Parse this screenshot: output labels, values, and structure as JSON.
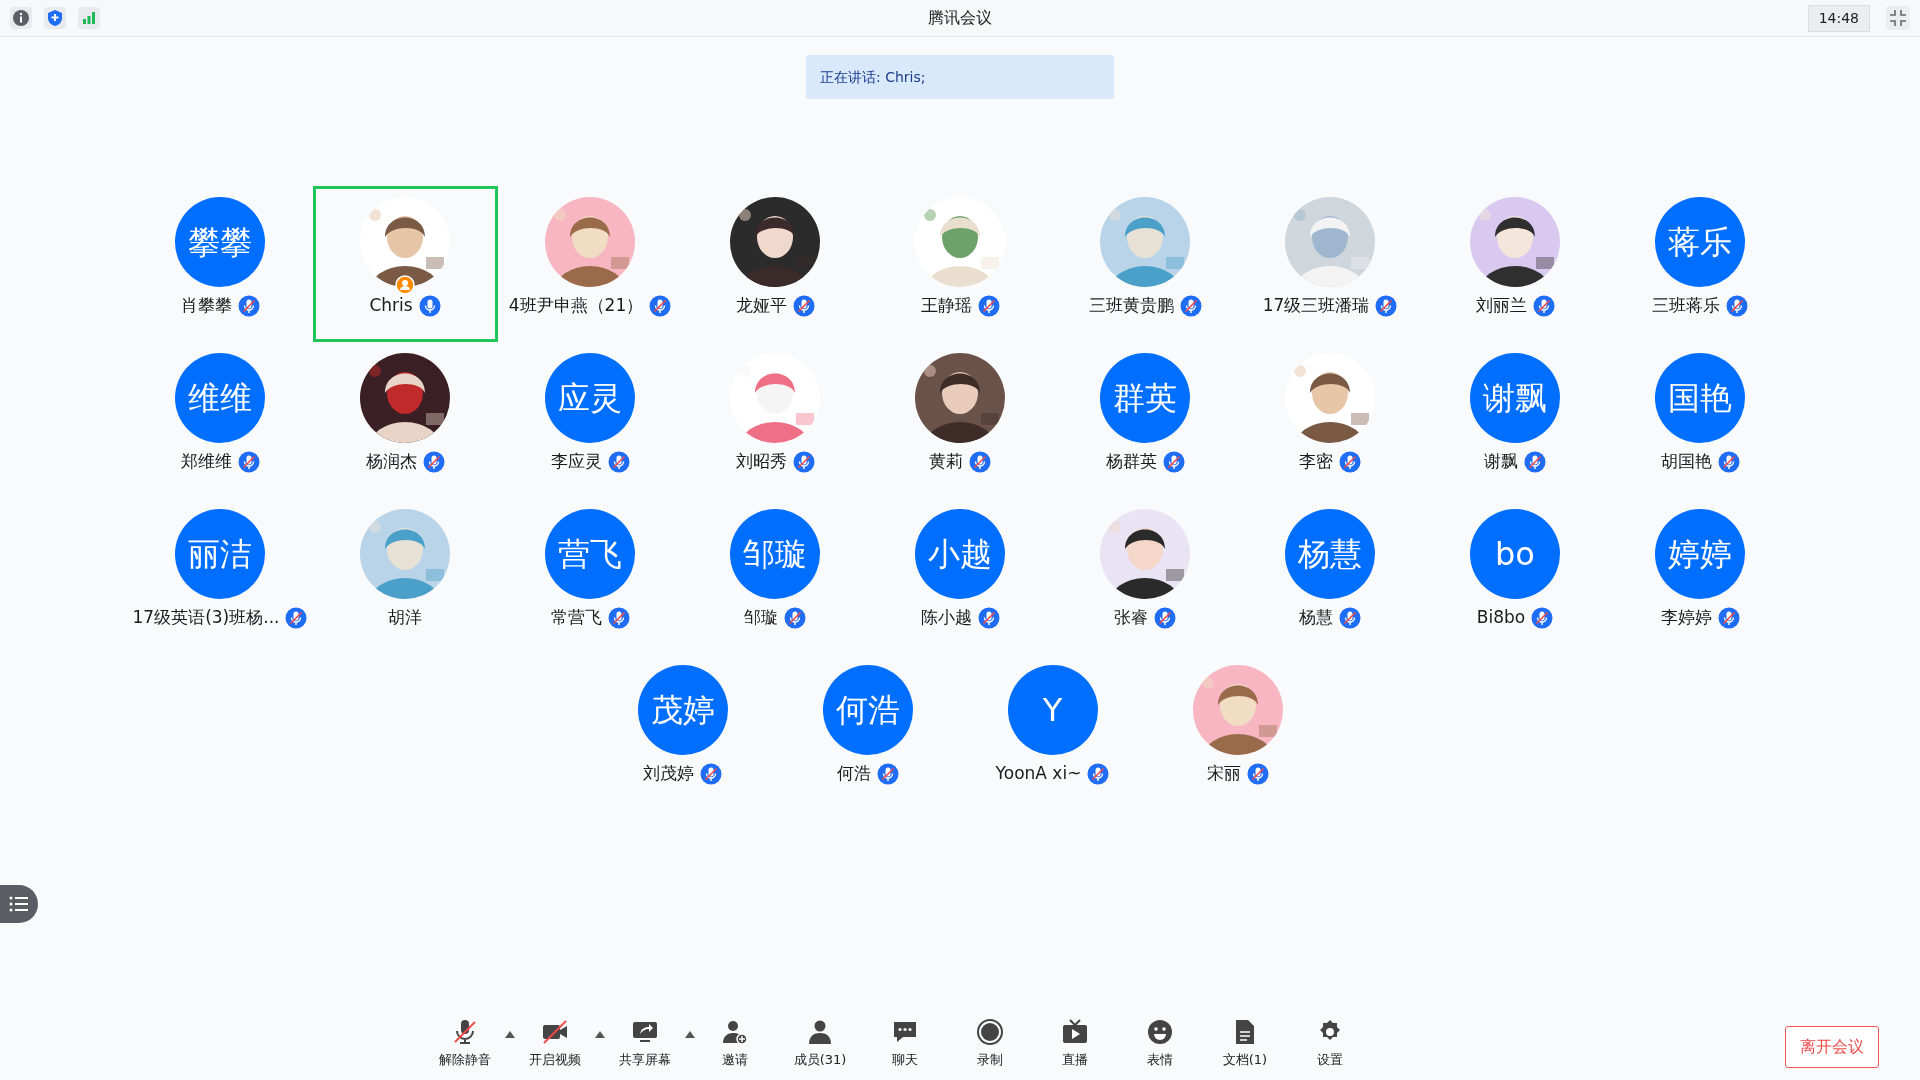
{
  "window": {
    "title": "腾讯会议",
    "time": "14:48"
  },
  "speaking_banner": "正在讲话: Chris;",
  "participants": [
    {
      "name": "肖攀攀",
      "avatar": {
        "kind": "initials",
        "text": "攀攀"
      },
      "muted": true,
      "selected": false,
      "host": false
    },
    {
      "name": "Chris",
      "muted": false,
      "selected": true,
      "host": true
    },
    {
      "name": "4班尹申燕（21）",
      "muted": true,
      "selected": false,
      "host": false
    },
    {
      "name": "龙娅平",
      "muted": true,
      "selected": false,
      "host": false
    },
    {
      "name": "王静瑶",
      "muted": true,
      "selected": false,
      "host": false
    },
    {
      "name": "三班黄贵鹏",
      "muted": true,
      "selected": false,
      "host": false
    },
    {
      "name": "17级三班潘瑞",
      "muted": true,
      "selected": false,
      "host": false
    },
    {
      "name": "刘丽兰",
      "muted": true,
      "selected": false,
      "host": false
    },
    {
      "name": "三班蒋乐",
      "avatar": {
        "kind": "initials",
        "text": "蒋乐"
      },
      "muted": true,
      "selected": false,
      "host": false
    },
    {
      "name": "郑维维",
      "avatar": {
        "kind": "initials",
        "text": "维维"
      },
      "muted": true,
      "selected": false,
      "host": false
    },
    {
      "name": "杨润杰",
      "muted": true,
      "selected": false,
      "host": false
    },
    {
      "name": "李应灵",
      "avatar": {
        "kind": "initials",
        "text": "应灵"
      },
      "muted": true,
      "selected": false,
      "host": false
    },
    {
      "name": "刘昭秀",
      "muted": true,
      "selected": false,
      "host": false
    },
    {
      "name": "黄莉",
      "muted": true,
      "selected": false,
      "host": false
    },
    {
      "name": "杨群英",
      "avatar": {
        "kind": "initials",
        "text": "群英"
      },
      "muted": true,
      "selected": false,
      "host": false
    },
    {
      "name": "李密",
      "muted": true,
      "selected": false,
      "host": false
    },
    {
      "name": "谢飘",
      "avatar": {
        "kind": "initials",
        "text": "谢飘"
      },
      "muted": true,
      "selected": false,
      "host": false
    },
    {
      "name": "胡国艳",
      "avatar": {
        "kind": "initials",
        "text": "国艳"
      },
      "muted": true,
      "selected": false,
      "host": false
    },
    {
      "name": "17级英语(3)班杨...",
      "avatar": {
        "kind": "initials",
        "text": "丽洁"
      },
      "muted": true,
      "selected": false,
      "host": false
    },
    {
      "name": "胡洋",
      "selected": false,
      "host": false
    },
    {
      "name": "常营飞",
      "avatar": {
        "kind": "initials",
        "text": "营飞"
      },
      "muted": true,
      "selected": false,
      "host": false
    },
    {
      "name": "邹璇",
      "avatar": {
        "kind": "initials",
        "text": "邹璇"
      },
      "muted": true,
      "selected": false,
      "host": false
    },
    {
      "name": "陈小越",
      "avatar": {
        "kind": "initials",
        "text": "小越"
      },
      "muted": true,
      "selected": false,
      "host": false
    },
    {
      "name": "张睿",
      "muted": true,
      "selected": false,
      "host": false
    },
    {
      "name": "杨慧",
      "avatar": {
        "kind": "initials",
        "text": "杨慧"
      },
      "muted": true,
      "selected": false,
      "host": false
    },
    {
      "name": "Bi8bo",
      "avatar": {
        "kind": "initials",
        "text": "bo"
      },
      "muted": true,
      "selected": false,
      "host": false
    },
    {
      "name": "李婷婷",
      "avatar": {
        "kind": "initials",
        "text": "婷婷"
      },
      "muted": true,
      "selected": false,
      "host": false
    },
    {
      "name": "刘茂婷",
      "avatar": {
        "kind": "initials",
        "text": "茂婷"
      },
      "muted": true,
      "selected": false,
      "host": false
    },
    {
      "name": "何浩",
      "avatar": {
        "kind": "initials",
        "text": "何浩"
      },
      "muted": true,
      "selected": false,
      "host": false
    },
    {
      "name": "YoonA xi~",
      "avatar": {
        "kind": "initials",
        "text": "Y"
      },
      "muted": true,
      "selected": false,
      "host": false
    },
    {
      "name": "宋丽",
      "muted": true,
      "selected": false,
      "host": false
    }
  ],
  "toolbar": [
    {
      "kind": "mic-off",
      "label": "解除静音",
      "caret": true
    },
    {
      "kind": "video-off",
      "label": "开启视频",
      "caret": true
    },
    {
      "kind": "share",
      "label": "共享屏幕",
      "caret": true
    },
    {
      "kind": "invite",
      "label": "邀请",
      "caret": false
    },
    {
      "kind": "members",
      "label": "成员(31)",
      "caret": false
    },
    {
      "kind": "chat",
      "label": "聊天",
      "caret": false
    },
    {
      "kind": "record",
      "label": "录制",
      "caret": false
    },
    {
      "kind": "live",
      "label": "直播",
      "caret": false
    },
    {
      "kind": "emoji",
      "label": "表情",
      "caret": false
    },
    {
      "kind": "docs",
      "label": "文档(1)",
      "caret": false
    },
    {
      "kind": "settings",
      "label": "设置",
      "caret": false
    }
  ],
  "leave_button": "离开会议"
}
